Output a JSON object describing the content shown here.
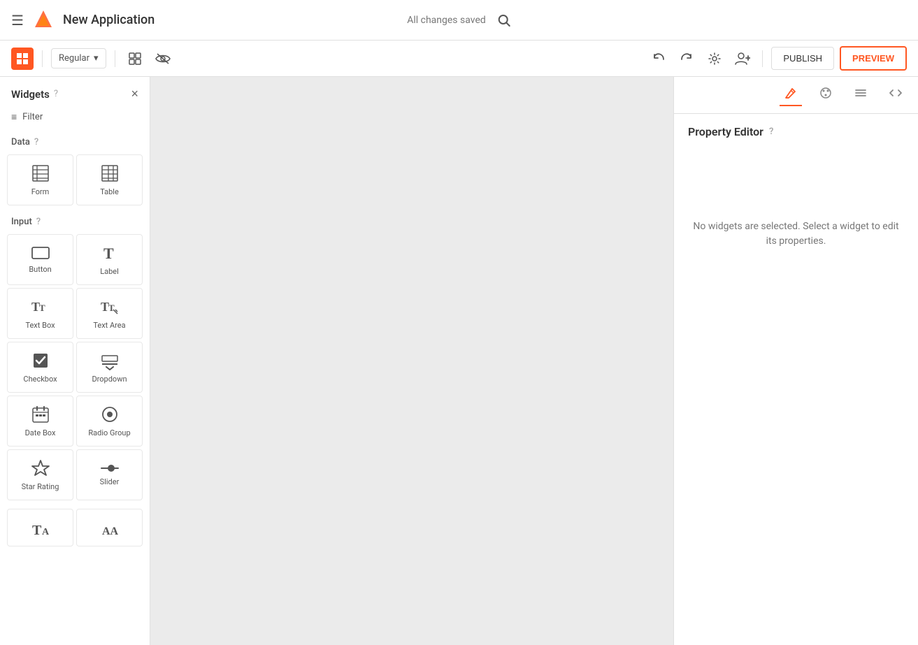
{
  "header": {
    "menu_icon": "☰",
    "app_title": "New Application",
    "changes_saved": "All changes saved",
    "search_placeholder": "Search"
  },
  "toolbar": {
    "regular_label": "Regular",
    "publish_label": "PUBLISH",
    "preview_label": "PREVIEW"
  },
  "widgets_panel": {
    "title": "Widgets",
    "filter_label": "Filter",
    "close_label": "×",
    "sections": [
      {
        "name": "Data",
        "widgets": [
          {
            "id": "form",
            "label": "Form",
            "icon": "form"
          },
          {
            "id": "table",
            "label": "Table",
            "icon": "table"
          }
        ]
      },
      {
        "name": "Input",
        "widgets": [
          {
            "id": "button",
            "label": "Button",
            "icon": "button"
          },
          {
            "id": "label",
            "label": "Label",
            "icon": "label"
          },
          {
            "id": "textbox",
            "label": "Text Box",
            "icon": "textbox"
          },
          {
            "id": "textarea",
            "label": "Text Area",
            "icon": "textarea"
          },
          {
            "id": "checkbox",
            "label": "Checkbox",
            "icon": "checkbox"
          },
          {
            "id": "dropdown",
            "label": "Dropdown",
            "icon": "dropdown"
          },
          {
            "id": "datebox",
            "label": "Date Box",
            "icon": "datebox"
          },
          {
            "id": "radiogroup",
            "label": "Radio Group",
            "icon": "radiogroup"
          },
          {
            "id": "starrating",
            "label": "Star Rating",
            "icon": "starrating"
          },
          {
            "id": "slider",
            "label": "Slider",
            "icon": "slider"
          }
        ]
      }
    ]
  },
  "property_editor": {
    "title": "Property Editor",
    "empty_message": "No widgets are selected. Select a widget to edit its properties."
  },
  "panel_tabs": [
    {
      "id": "style",
      "label": "Style",
      "active": true
    },
    {
      "id": "theme",
      "label": "Theme"
    },
    {
      "id": "data",
      "label": "Data"
    },
    {
      "id": "code",
      "label": "Code"
    }
  ]
}
